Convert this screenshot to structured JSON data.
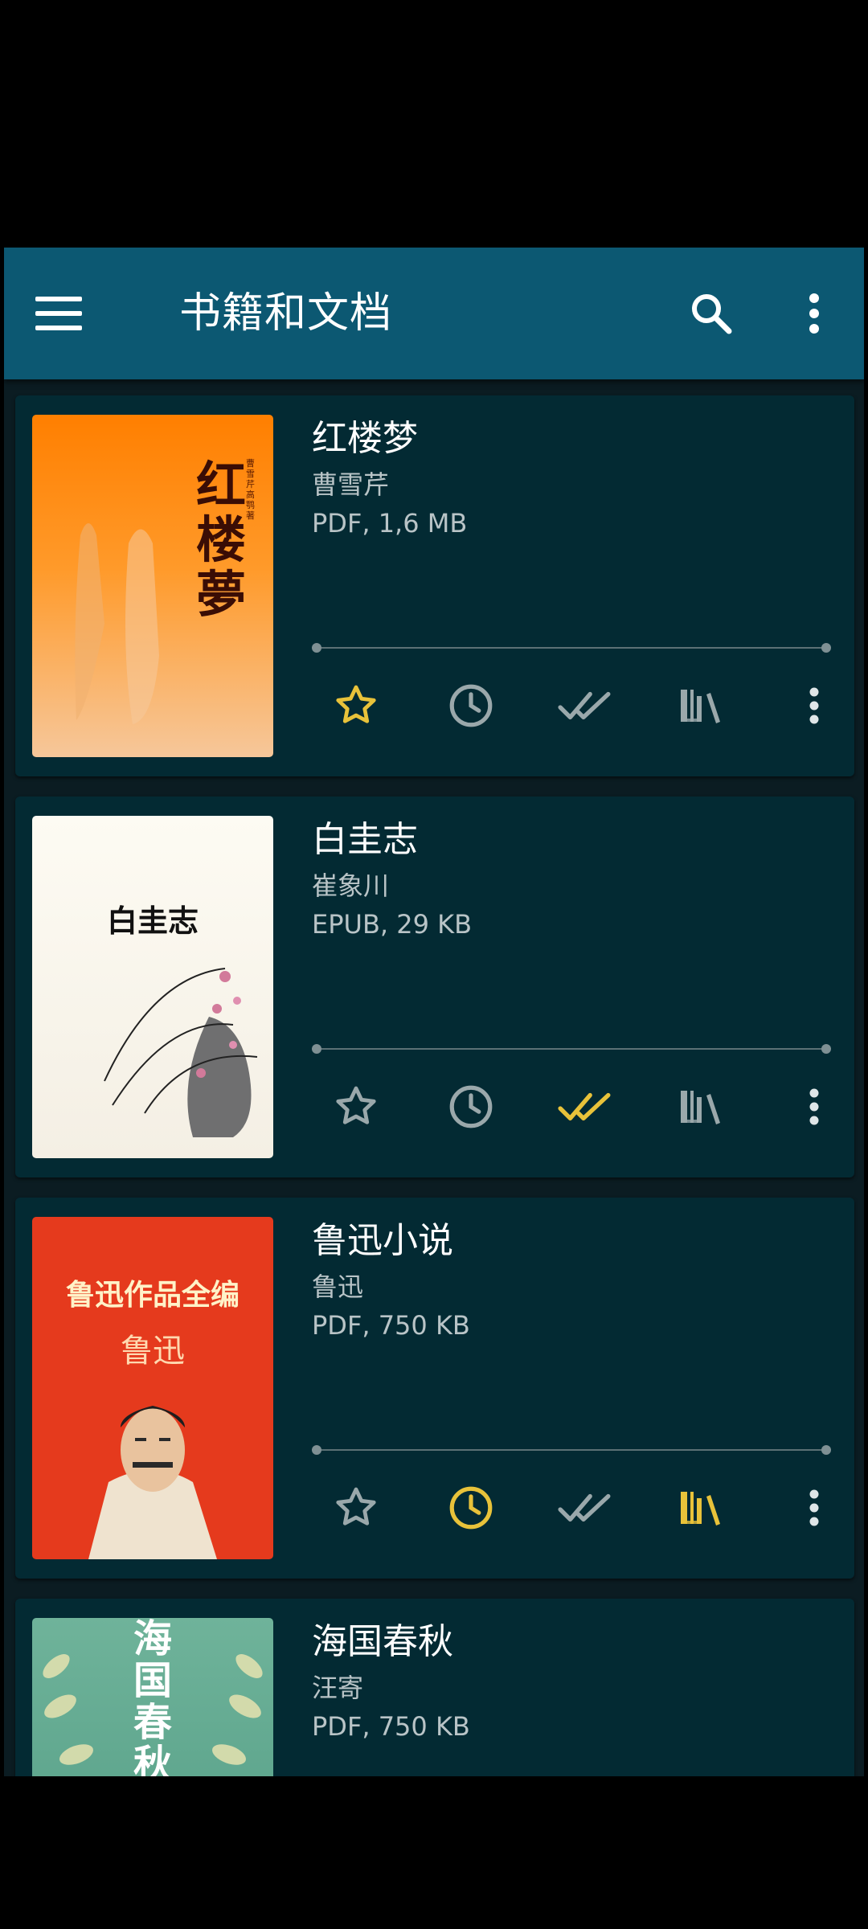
{
  "toolbar": {
    "title": "书籍和文档",
    "menu_icon": "hamburger-menu-icon",
    "search_icon": "search-icon",
    "overflow_icon": "more-vertical-icon",
    "bg_color": "#0c5872"
  },
  "colors": {
    "active": "#e8c23a",
    "inactive": "#9aa8ab",
    "card_bg": "#032a33",
    "list_bg": "#0b1c22"
  },
  "books": [
    {
      "title": "红楼梦",
      "author": "曹雪芹",
      "meta": "PDF, 1,6 MB",
      "cover_text": [
        "红",
        "楼",
        "夢"
      ],
      "cover_small": "曹雪芹 高 鹗 著",
      "progress": 0,
      "favorite": true,
      "to_read": false,
      "finished": false,
      "in_collection": false
    },
    {
      "title": "白圭志",
      "author": "崔象川",
      "meta": "EPUB, 29 KB",
      "cover_text": [
        "白圭志"
      ],
      "progress": 0,
      "favorite": false,
      "to_read": false,
      "finished": true,
      "in_collection": false
    },
    {
      "title": "鲁迅小说",
      "author": "鲁迅",
      "meta": "PDF, 750 KB",
      "cover_text": [
        "鲁迅作品全编",
        "鲁迅"
      ],
      "progress": 0,
      "favorite": false,
      "to_read": true,
      "finished": false,
      "in_collection": true
    },
    {
      "title": "海国春秋",
      "author": "汪寄",
      "meta": "PDF, 750 KB",
      "cover_text": [
        "海",
        "国",
        "春",
        "秋"
      ],
      "progress": 0
    }
  ],
  "action_icons": [
    "star-icon",
    "clock-icon",
    "double-check-icon",
    "library-icon",
    "more-vertical-icon"
  ]
}
